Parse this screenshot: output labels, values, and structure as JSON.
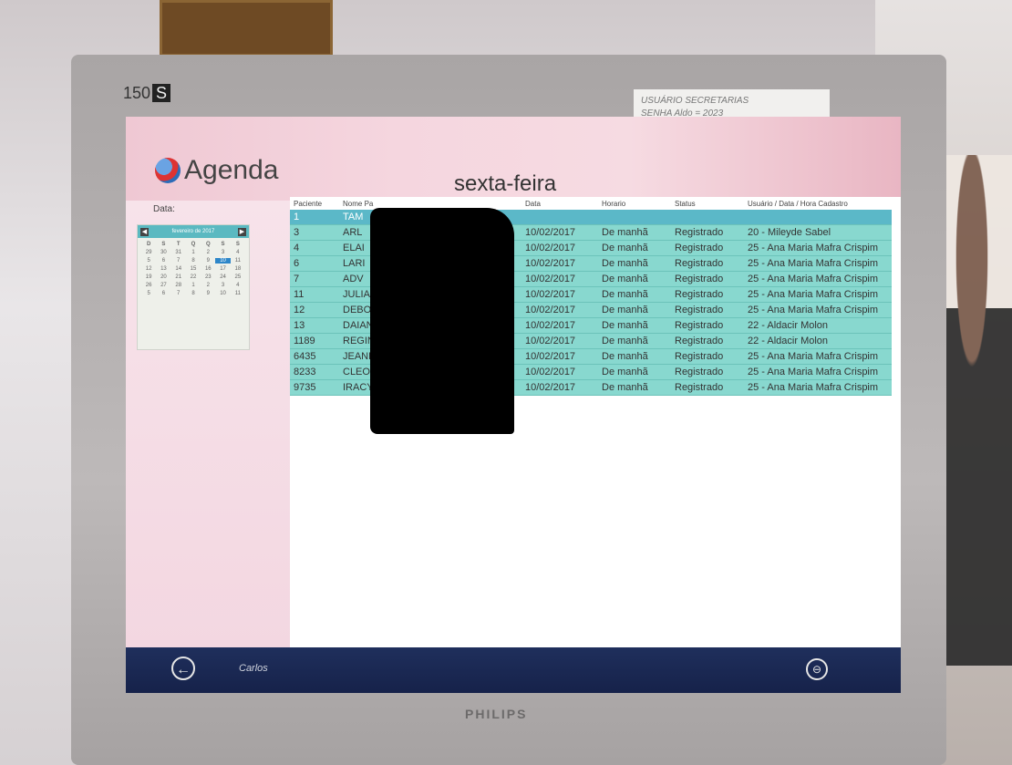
{
  "monitor": {
    "model_prefix": "150",
    "model_suffix": "S",
    "brand": "PHILIPS"
  },
  "sticky_note": {
    "line1": "USUÁRIO   SECRETARIAS",
    "line2": "SENHA    Aldo = 2023"
  },
  "app": {
    "title": "Agenda",
    "day": "sexta-feira"
  },
  "sidebar": {
    "data_label": "Data:"
  },
  "calendar": {
    "month": "fevereiro de 2017",
    "prev": "◀",
    "next": "▶",
    "weekdays": [
      "D",
      "S",
      "T",
      "Q",
      "Q",
      "S",
      "S"
    ],
    "days": [
      "29",
      "30",
      "31",
      "1",
      "2",
      "3",
      "4",
      "5",
      "6",
      "7",
      "8",
      "9",
      "10",
      "11",
      "12",
      "13",
      "14",
      "15",
      "16",
      "17",
      "18",
      "19",
      "20",
      "21",
      "22",
      "23",
      "24",
      "25",
      "26",
      "27",
      "28",
      "1",
      "2",
      "3",
      "4",
      "5",
      "6",
      "7",
      "8",
      "9",
      "10",
      "11"
    ],
    "selected": "10"
  },
  "table": {
    "headers": [
      "Paciente",
      "Nome Pa",
      "Data",
      "Horario",
      "Status",
      "Usuário / Data / Hora Cadastro"
    ],
    "rows": [
      [
        "1",
        "TAM",
        "",
        "",
        "",
        ""
      ],
      [
        "3",
        "ARL",
        "10/02/2017",
        "De manhã",
        "Registrado",
        "20 - Mileyde Sabel"
      ],
      [
        "4",
        "ELAI",
        "10/02/2017",
        "De manhã",
        "Registrado",
        "25 - Ana Maria Mafra Crispim"
      ],
      [
        "6",
        "LARI",
        "10/02/2017",
        "De manhã",
        "Registrado",
        "25 - Ana Maria Mafra Crispim"
      ],
      [
        "7",
        "ADV",
        "10/02/2017",
        "De manhã",
        "Registrado",
        "25 - Ana Maria Mafra Crispim"
      ],
      [
        "11",
        "JULIA",
        "10/02/2017",
        "De manhã",
        "Registrado",
        "25 - Ana Maria Mafra Crispim"
      ],
      [
        "12",
        "DEBO",
        "10/02/2017",
        "De manhã",
        "Registrado",
        "25 - Ana Maria Mafra Crispim"
      ],
      [
        "13",
        "DAIAN",
        "10/02/2017",
        "De manhã",
        "Registrado",
        "22 - Aldacir Molon"
      ],
      [
        "1189",
        "REGIN",
        "10/02/2017",
        "De manhã",
        "Registrado",
        "22 - Aldacir Molon"
      ],
      [
        "6435",
        "JEANE",
        "10/02/2017",
        "De manhã",
        "Registrado",
        "25 - Ana Maria Mafra Crispim"
      ],
      [
        "8233",
        "CLEO",
        "10/02/2017",
        "De manhã",
        "Registrado",
        "25 - Ana Maria Mafra Crispim"
      ],
      [
        "9735",
        "IRACY",
        "10/02/2017",
        "De manhã",
        "Registrado",
        "25 - Ana Maria Mafra Crispim"
      ]
    ]
  },
  "footer": {
    "user": "Carlos",
    "back_icon": "back-arrow-icon",
    "lock_icon": "lock-icon"
  },
  "colors": {
    "row": "#88d8cf",
    "selected_row": "#5bb8c8",
    "footer": "#1f2f5c",
    "banner": "#f5d6df"
  }
}
